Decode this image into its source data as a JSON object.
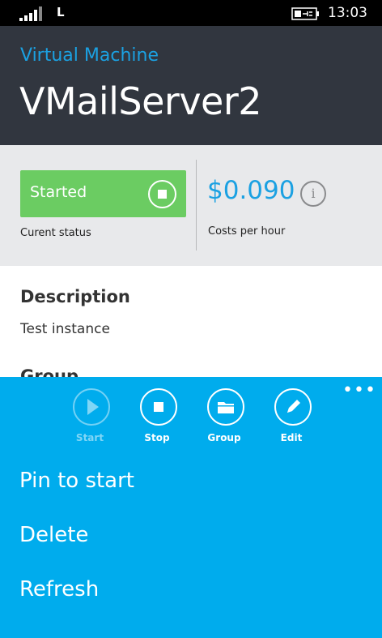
{
  "status_bar": {
    "network": "L",
    "time": "13:03"
  },
  "header": {
    "subtitle": "Virtual Machine",
    "title": "VMailServer2"
  },
  "summary": {
    "status_value": "Started",
    "status_caption": "Curent status",
    "price": "$0.090",
    "price_caption": "Costs per hour"
  },
  "details": {
    "description_label": "Description",
    "description_value": "Test instance",
    "group_label": "Group"
  },
  "app_bar": {
    "more": "•••",
    "buttons": [
      {
        "label": "Start",
        "icon": "play-icon",
        "enabled": false
      },
      {
        "label": "Stop",
        "icon": "stop-icon",
        "enabled": true
      },
      {
        "label": "Group",
        "icon": "folder-icon",
        "enabled": true
      },
      {
        "label": "Edit",
        "icon": "pencil-icon",
        "enabled": true
      }
    ],
    "menu": [
      "Pin to start",
      "Delete",
      "Refresh"
    ]
  },
  "colors": {
    "accent": "#1ba1e2",
    "header_bg": "#31363f",
    "status_green": "#6bcc62",
    "app_bar_bg": "#00aced"
  }
}
